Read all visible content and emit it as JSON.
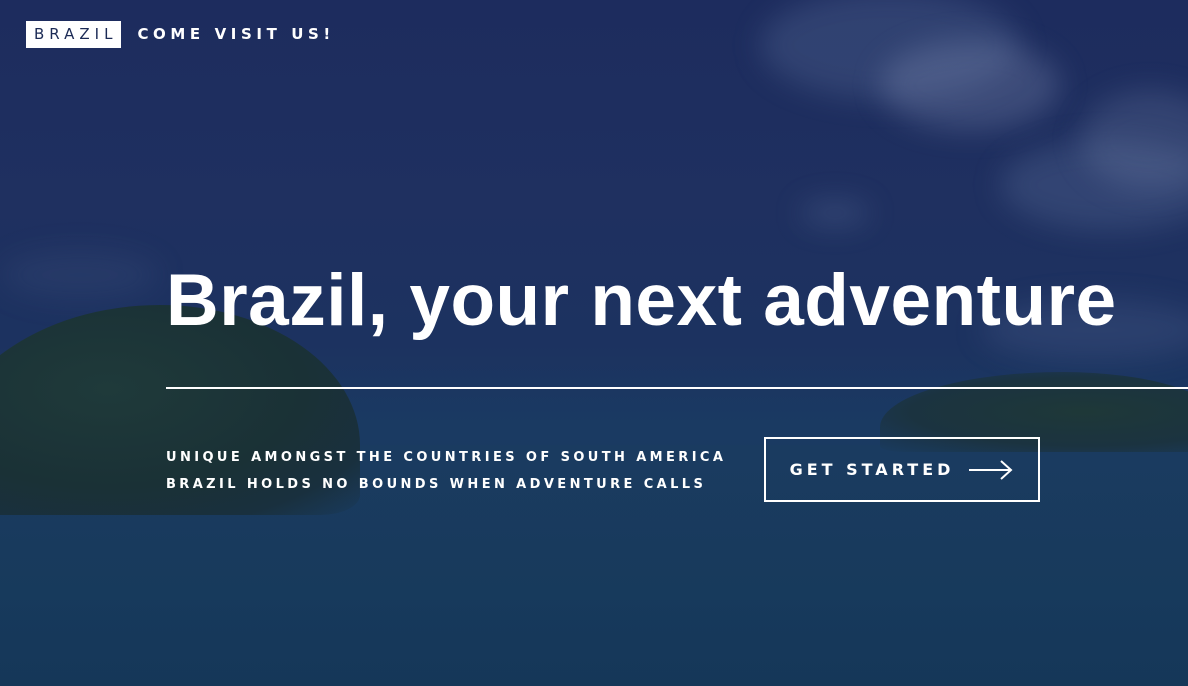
{
  "nav": {
    "brand": "BRAZIL",
    "tagline": "COME VISIT US!"
  },
  "hero": {
    "headline": "Brazil, your next adventure",
    "subtext_lines": [
      "UNIQUE AMONGST THE COUNTRIES OF SOUTH AMERICA",
      "BRAZIL HOLDS NO BOUNDS WHEN ADVENTURE CALLS"
    ],
    "cta_label": "GET STARTED",
    "cta_icon": "arrow-right-icon"
  },
  "colors": {
    "overlay": "#1d2c5e",
    "text": "#ffffff",
    "brand_text": "#1b2a55"
  }
}
